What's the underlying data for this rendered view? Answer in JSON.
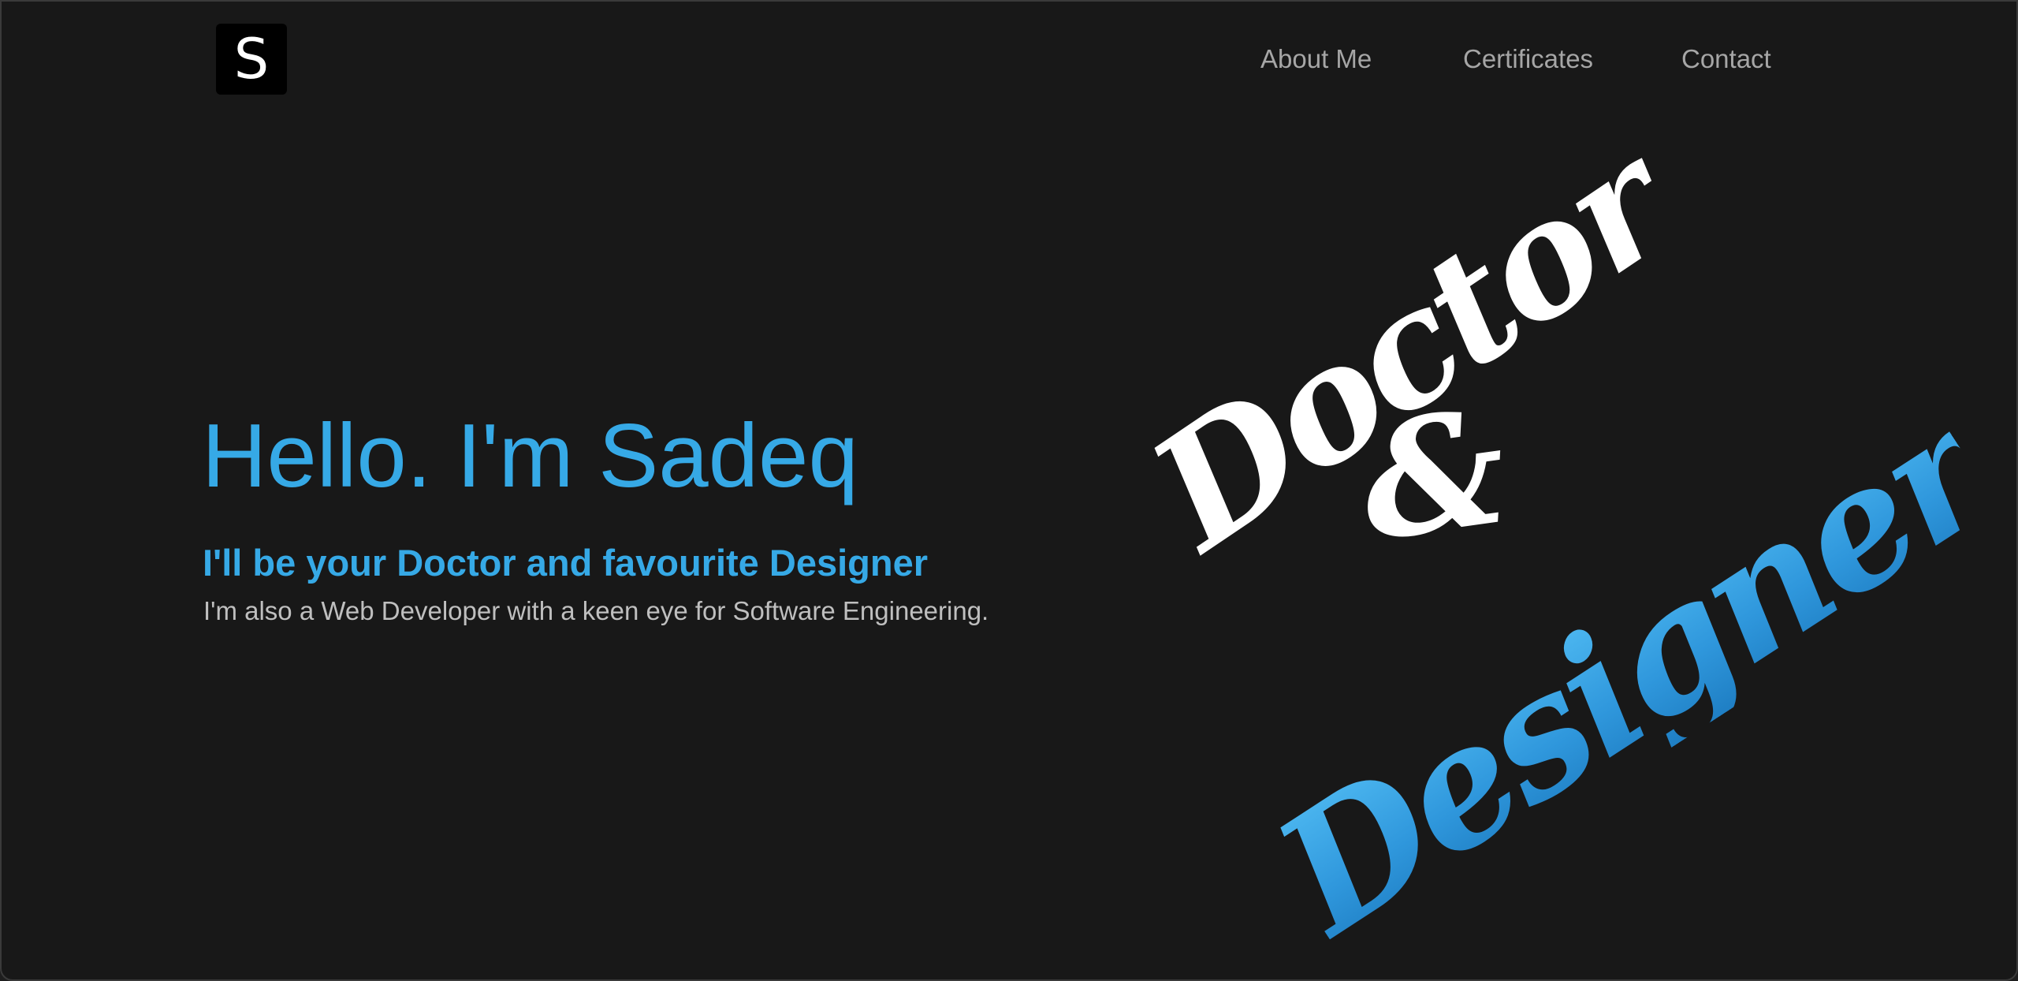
{
  "header": {
    "logo_letter": "S",
    "nav": [
      {
        "label": "About Me"
      },
      {
        "label": "Certificates"
      },
      {
        "label": "Contact"
      }
    ]
  },
  "hero": {
    "title": "Hello. I'm Sadeq",
    "subtitle": "I'll be your Doctor and favourite Designer",
    "description": "I'm also a Web Developer with a keen eye for Software Engineering."
  },
  "art": {
    "word_1": "Doctor",
    "ampersand": "&",
    "word_2": "Designer"
  },
  "colors": {
    "background": "#181818",
    "accent": "#36a9e6",
    "nav_text": "#a6a6a6",
    "body_text": "#bfbfbf",
    "art_white": "#ffffff"
  }
}
